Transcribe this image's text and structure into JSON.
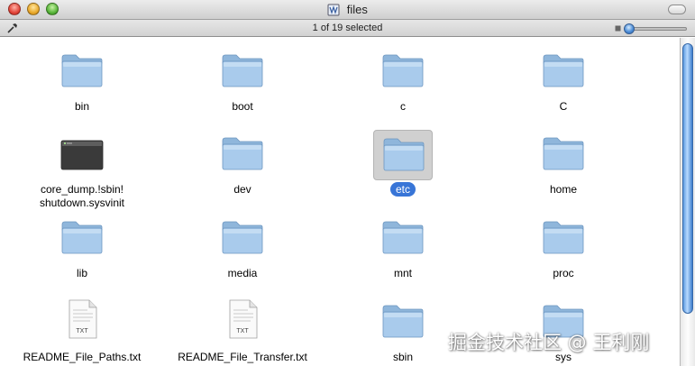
{
  "window": {
    "title": "files"
  },
  "status": {
    "selection_text": "1 of 19 selected"
  },
  "items": [
    {
      "label": "bin"
    },
    {
      "label": "boot"
    },
    {
      "label": "c"
    },
    {
      "label": "C"
    },
    {
      "label": "core_dump.!sbin!\nshutdown.sysvinit"
    },
    {
      "label": "dev"
    },
    {
      "label": "etc"
    },
    {
      "label": "home"
    },
    {
      "label": "lib"
    },
    {
      "label": "media"
    },
    {
      "label": "mnt"
    },
    {
      "label": "proc"
    },
    {
      "label": "README_File_Paths.txt"
    },
    {
      "label": "README_File_Transfer.txt"
    },
    {
      "label": "sbin"
    },
    {
      "label": "sys"
    }
  ],
  "file_badge": "TXT",
  "watermark": "掘金技术社区 @ 王利刚",
  "colors": {
    "selection": "#3875d7",
    "folder": "#9cc3e6"
  }
}
